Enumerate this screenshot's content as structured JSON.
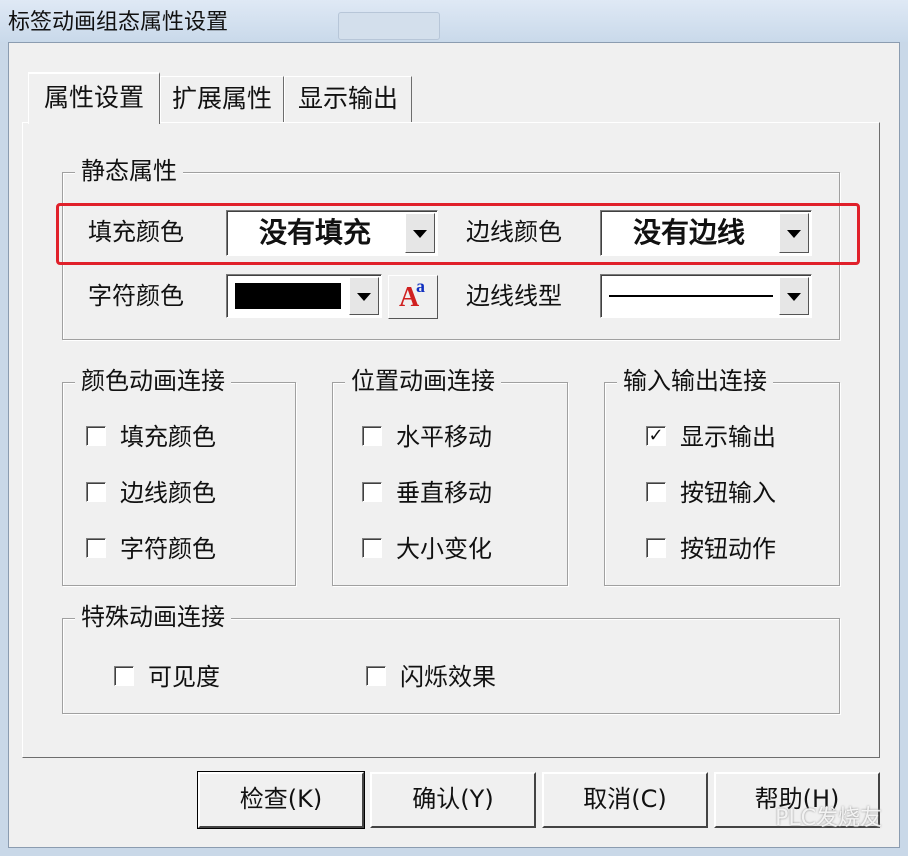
{
  "window": {
    "title": "标签动画组态属性设置"
  },
  "tabs": [
    {
      "label": "属性设置"
    },
    {
      "label": "扩展属性"
    },
    {
      "label": "显示输出"
    }
  ],
  "static_group": {
    "title": "静态属性",
    "fill_label": "填充颜色",
    "fill_value": "没有填充",
    "border_label": "边线颜色",
    "border_value": "没有边线",
    "char_label": "字符颜色",
    "char_color": "#000000",
    "linetype_label": "边线线型",
    "font_button_text": "A",
    "font_button_small": "a"
  },
  "color_group": {
    "title": "颜色动画连接",
    "items": [
      {
        "label": "填充颜色",
        "checked": false
      },
      {
        "label": "边线颜色",
        "checked": false
      },
      {
        "label": "字符颜色",
        "checked": false
      }
    ]
  },
  "position_group": {
    "title": "位置动画连接",
    "items": [
      {
        "label": "水平移动",
        "checked": false
      },
      {
        "label": "垂直移动",
        "checked": false
      },
      {
        "label": "大小变化",
        "checked": false
      }
    ]
  },
  "io_group": {
    "title": "输入输出连接",
    "items": [
      {
        "label": "显示输出",
        "checked": true,
        "mark": "✓"
      },
      {
        "label": "按钮输入",
        "checked": false
      },
      {
        "label": "按钮动作",
        "checked": false
      }
    ]
  },
  "special_group": {
    "title": "特殊动画连接",
    "items": [
      {
        "label": "可见度",
        "checked": false
      },
      {
        "label": "闪烁效果",
        "checked": false
      }
    ]
  },
  "buttons": {
    "check": "检查(K)",
    "ok": "确认(Y)",
    "cancel": "取消(C)",
    "help": "帮助(H)"
  },
  "watermark": "PLC发烧友",
  "colors": {
    "highlight": "#e0202a",
    "window_bg": "#f0f0f0",
    "title_bg": "#c9d9ea"
  }
}
